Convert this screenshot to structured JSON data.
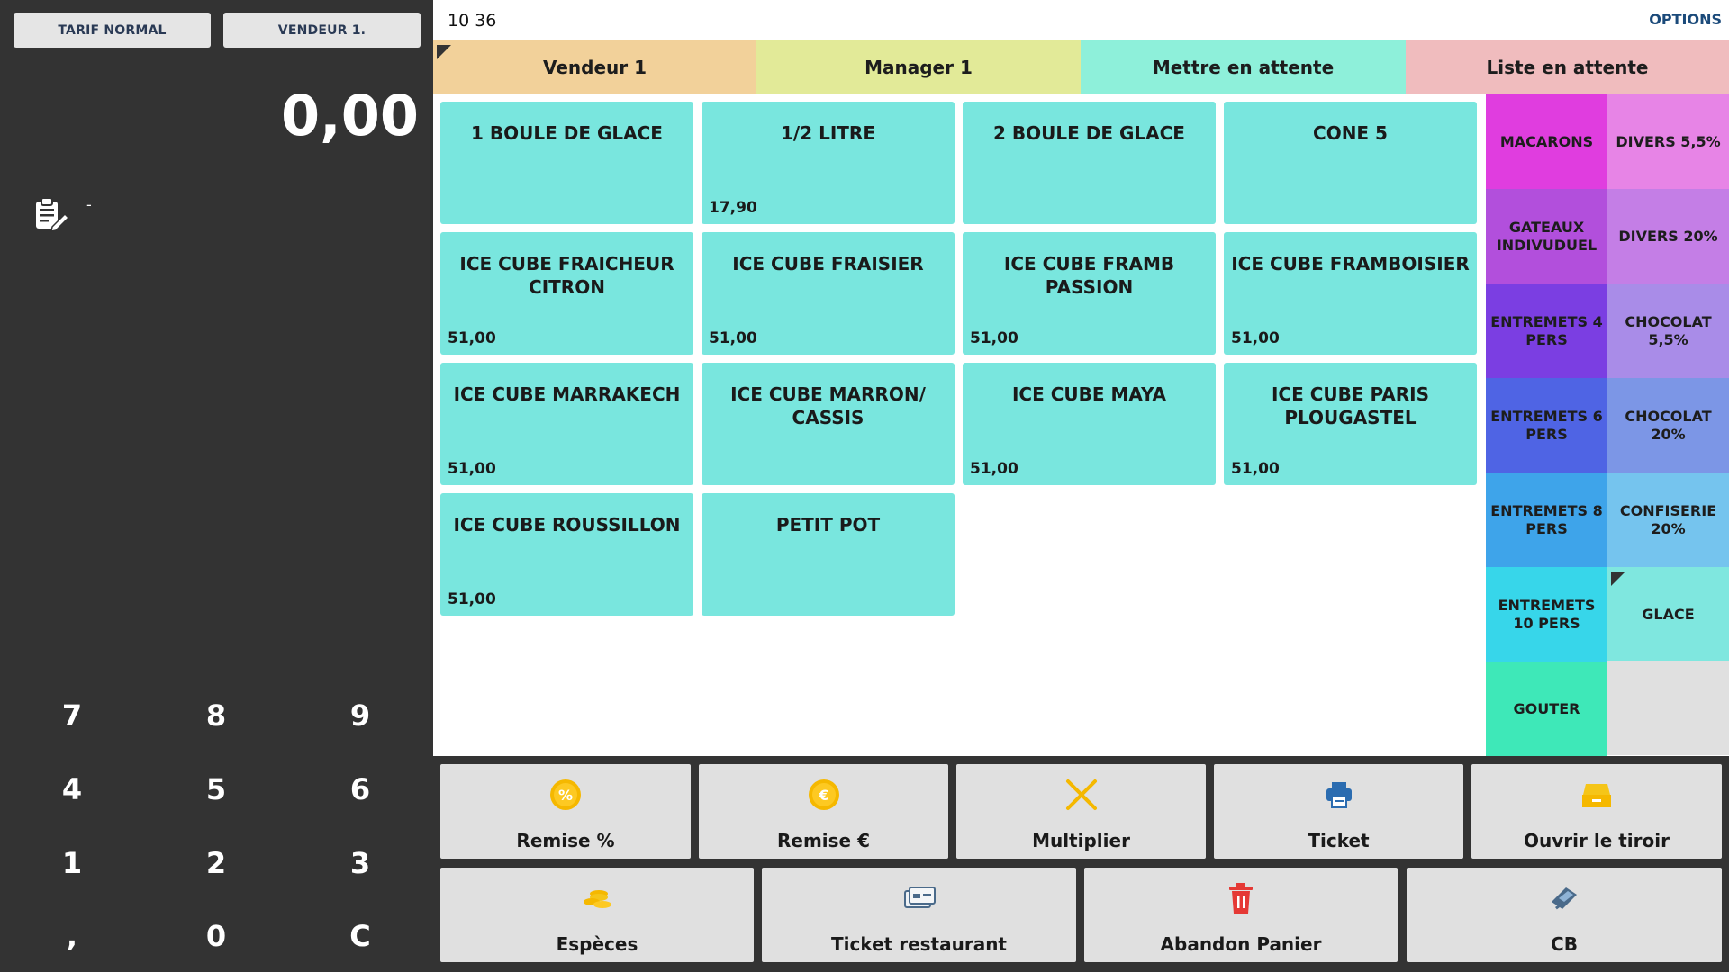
{
  "left": {
    "tarif_label": "TARIF NORMAL",
    "vendeur_label": "VENDEUR 1.",
    "total": "0,00",
    "note_text": "-",
    "keypad": [
      "7",
      "8",
      "9",
      "4",
      "5",
      "6",
      "1",
      "2",
      "3",
      ",",
      "0",
      "C"
    ]
  },
  "header": {
    "clock": "10 36",
    "options_label": "OPTIONS"
  },
  "tabs": [
    {
      "label": "Vendeur 1",
      "color": "#f2d19a"
    },
    {
      "label": "Manager 1",
      "color": "#e2ea98"
    },
    {
      "label": "Mettre en attente",
      "color": "#8ef0da"
    },
    {
      "label": "Liste en attente",
      "color": "#f0bcbe"
    }
  ],
  "products": [
    {
      "name": "1 BOULE DE GLACE",
      "price": ""
    },
    {
      "name": "1/2 LITRE",
      "price": "17,90"
    },
    {
      "name": "2 BOULE DE GLACE",
      "price": ""
    },
    {
      "name": "CONE 5",
      "price": ""
    },
    {
      "name": "ICE CUBE FRAICHEUR CITRON",
      "price": "51,00"
    },
    {
      "name": "ICE CUBE FRAISIER",
      "price": "51,00"
    },
    {
      "name": "ICE CUBE FRAMB PASSION",
      "price": "51,00"
    },
    {
      "name": "ICE CUBE FRAMBOISIER",
      "price": "51,00"
    },
    {
      "name": "ICE CUBE MARRAKECH",
      "price": "51,00"
    },
    {
      "name": "ICE CUBE MARRON/ CASSIS",
      "price": ""
    },
    {
      "name": "ICE CUBE MAYA",
      "price": "51,00"
    },
    {
      "name": "ICE CUBE PARIS PLOUGASTEL",
      "price": "51,00"
    },
    {
      "name": "ICE CUBE ROUSSILLON",
      "price": "51,00"
    },
    {
      "name": "PETIT POT",
      "price": ""
    }
  ],
  "categories": [
    {
      "label": "MACARONS",
      "color": "#e03ddf"
    },
    {
      "label": "DIVERS 5,5%",
      "color": "#e784e6"
    },
    {
      "label": "GATEAUX INDIVUDUEL",
      "color": "#b24fdc"
    },
    {
      "label": "DIVERS 20%",
      "color": "#c47ee6"
    },
    {
      "label": "ENTREMETS 4 PERS",
      "color": "#7b3ee2"
    },
    {
      "label": "CHOCOLAT 5,5%",
      "color": "#a98ce8"
    },
    {
      "label": "ENTREMETS 6 PERS",
      "color": "#4f64e4"
    },
    {
      "label": "CHOCOLAT 20%",
      "color": "#7c96e6"
    },
    {
      "label": "ENTREMETS 8 PERS",
      "color": "#3ea4ea"
    },
    {
      "label": "CONFISERIE 20%",
      "color": "#75c4ee"
    },
    {
      "label": "ENTREMETS 10 PERS",
      "color": "#37d6ea"
    },
    {
      "label": "GLACE",
      "color": "#7fe7df"
    },
    {
      "label": "GOUTER",
      "color": "#3ee8b8"
    }
  ],
  "actions_row1": [
    {
      "label": "Remise %",
      "icon": "percent-coin-icon"
    },
    {
      "label": "Remise €",
      "icon": "euro-coin-icon"
    },
    {
      "label": "Multiplier",
      "icon": "multiply-icon"
    },
    {
      "label": "Ticket",
      "icon": "printer-icon"
    },
    {
      "label": "Ouvrir le tiroir",
      "icon": "cash-drawer-icon"
    }
  ],
  "actions_row2": [
    {
      "label": "Espèces",
      "icon": "coins-icon"
    },
    {
      "label": "Ticket restaurant",
      "icon": "meal-voucher-icon"
    },
    {
      "label": "Abandon Panier",
      "icon": "trash-icon"
    },
    {
      "label": "CB",
      "icon": "card-terminal-icon"
    }
  ]
}
